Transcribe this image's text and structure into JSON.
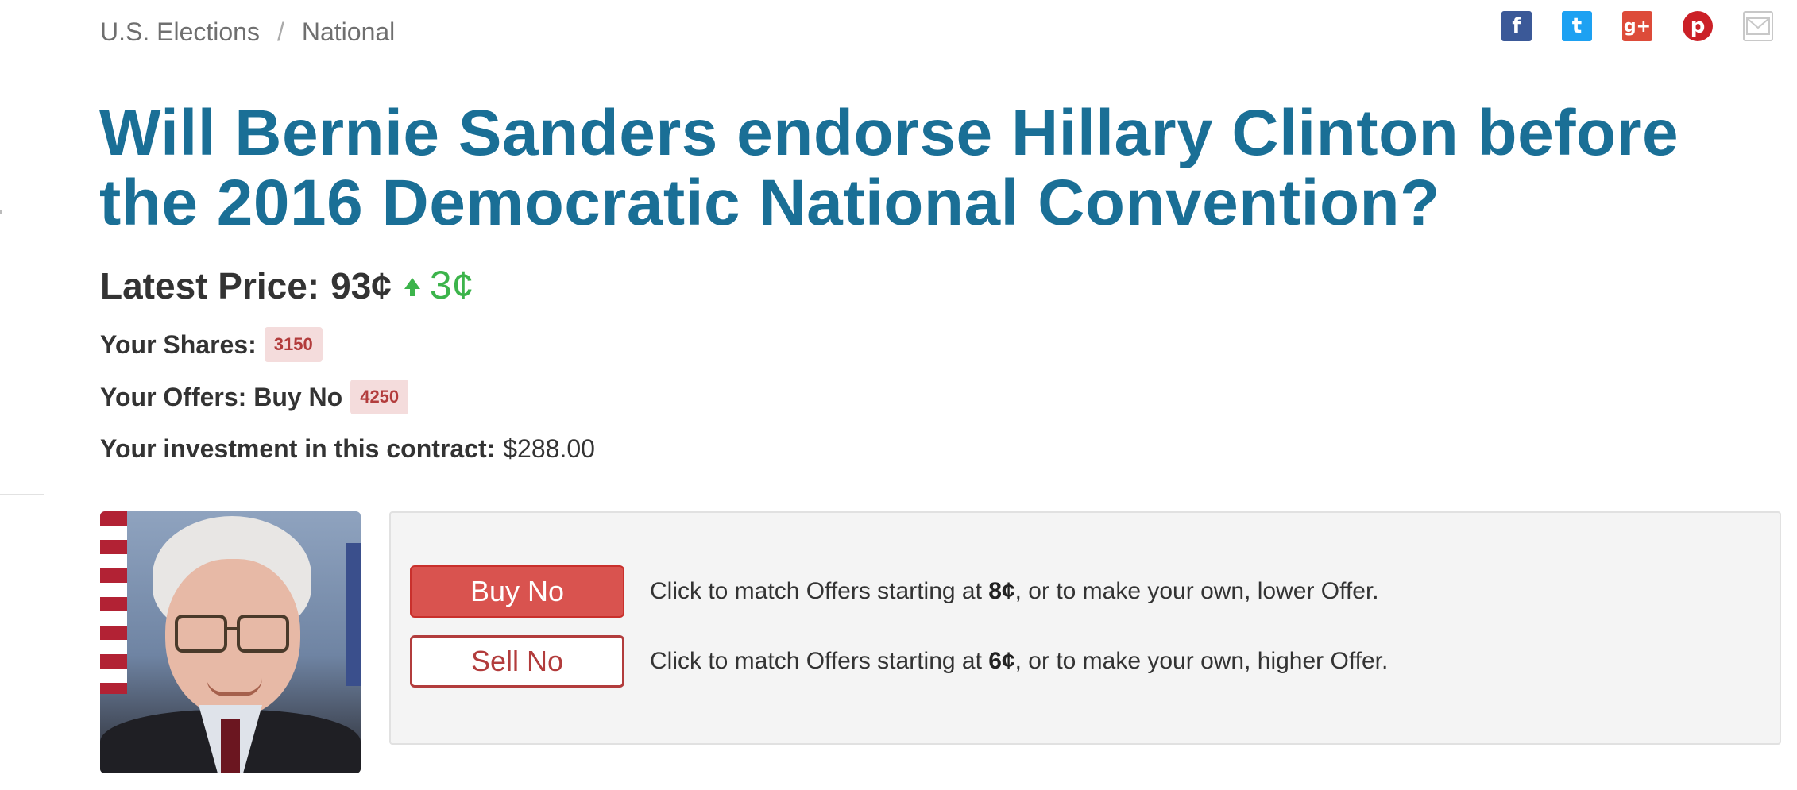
{
  "breadcrumb": {
    "items": [
      "U.S. Elections",
      "National"
    ],
    "separator": "/"
  },
  "share": {
    "icons": [
      "facebook-icon",
      "twitter-icon",
      "google-plus-icon",
      "pinterest-icon",
      "email-icon"
    ],
    "glyphs": {
      "facebook": "f",
      "twitter": "t",
      "google_plus": "g+",
      "pinterest": "p",
      "email": "✉"
    }
  },
  "title": "Will Bernie Sanders endorse Hillary Clinton before the 2016 Democratic National Convention?",
  "latest_price": {
    "label": "Latest Price:",
    "value": "93¢",
    "change": "3¢",
    "direction": "up",
    "change_color": "#3cb44b"
  },
  "shares": {
    "label": "Your Shares:",
    "count": "3150"
  },
  "offers": {
    "label": "Your Offers: Buy No",
    "count": "4250"
  },
  "investment": {
    "label": "Your investment in this contract:",
    "amount": "$288.00"
  },
  "candidate_photo": {
    "alt_icon": "portrait-photo"
  },
  "actions": {
    "buy": {
      "label": "Buy No",
      "text_before": "Click to match Offers starting at ",
      "price": "8¢",
      "text_after": ", or to make your own, lower Offer."
    },
    "sell": {
      "label": "Sell No",
      "text_before": "Click to match Offers starting at ",
      "price": "6¢",
      "text_after": ", or to make your own, higher Offer."
    }
  },
  "colors": {
    "title": "#1a6f96",
    "buy_button": "#d9534f",
    "sell_border": "#b23c3c",
    "badge_bg": "#f4dcdc"
  }
}
